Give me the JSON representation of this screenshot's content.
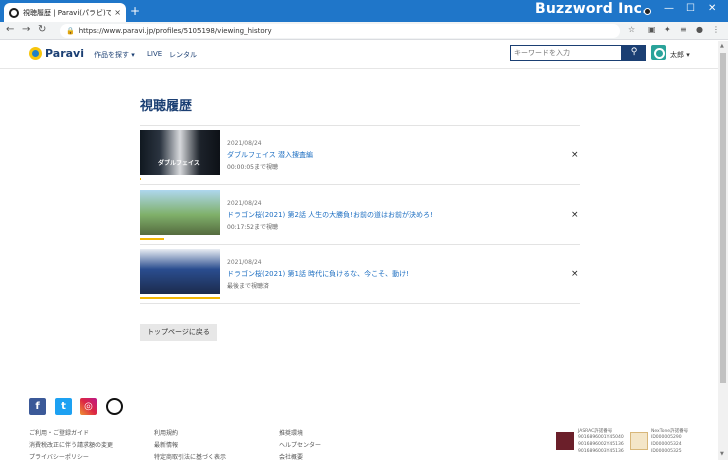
{
  "browser": {
    "tab_title": "視聴履歴 | Paravi(パラビ)で見る",
    "tab_close": "×",
    "new_tab": "+",
    "brand": "Buzzword Inc.",
    "url": "https://www.paravi.jp/profiles/5105198/viewing_history"
  },
  "header": {
    "logo_text": "Paravi",
    "nav": [
      {
        "label": "作品を探す ▾"
      },
      {
        "label": "LIVE"
      },
      {
        "label": "レンタル"
      }
    ],
    "search_placeholder": "キーワードを入力",
    "user_name": "太郎 ▾"
  },
  "main": {
    "title": "視聴履歴",
    "items": [
      {
        "date": "2021/08/24",
        "title": "ダブルフェイス 潜入捜査編",
        "status": "00:00:05まで視聴",
        "thumb_caption": "ダブルフェイス",
        "progress": 0.01,
        "close": "×"
      },
      {
        "date": "2021/08/24",
        "title": "ドラゴン桜(2021) 第2話 人生の大勝負!お前の道はお前が決めろ!",
        "status": "00:17:52まで視聴",
        "thumb_caption": "",
        "progress": 0.3,
        "close": "×"
      },
      {
        "date": "2021/08/24",
        "title": "ドラゴン桜(2021) 第1話 時代に負けるな、今こそ、動け!",
        "status": "最後まで視聴済",
        "thumb_caption": "",
        "progress": 1.0,
        "close": "×"
      }
    ],
    "back_button": "トップページに戻る"
  },
  "footer": {
    "col1": [
      "ご利用・ご登録ガイド",
      "消費税改正に伴う請求額の変更",
      "プライバシーポリシー"
    ],
    "col2": [
      "利用規約",
      "最新情報",
      "特定商取引法に基づく表示"
    ],
    "col3": [
      "推奨環境",
      "ヘルプセンター",
      "会社概要"
    ],
    "jasrac": [
      "JASRAC許諾番号",
      "9016896001Y45040",
      "9016896002Y45136",
      "9016896003Y45136"
    ],
    "nextone": [
      "NexTone許諾番号",
      "ID000005290",
      "ID000005324",
      "ID000005325"
    ]
  },
  "colors": {
    "accent": "#1b3f73",
    "link": "#1e6fc2",
    "titlebar": "#1f76c9",
    "progress": "#f2b705"
  }
}
